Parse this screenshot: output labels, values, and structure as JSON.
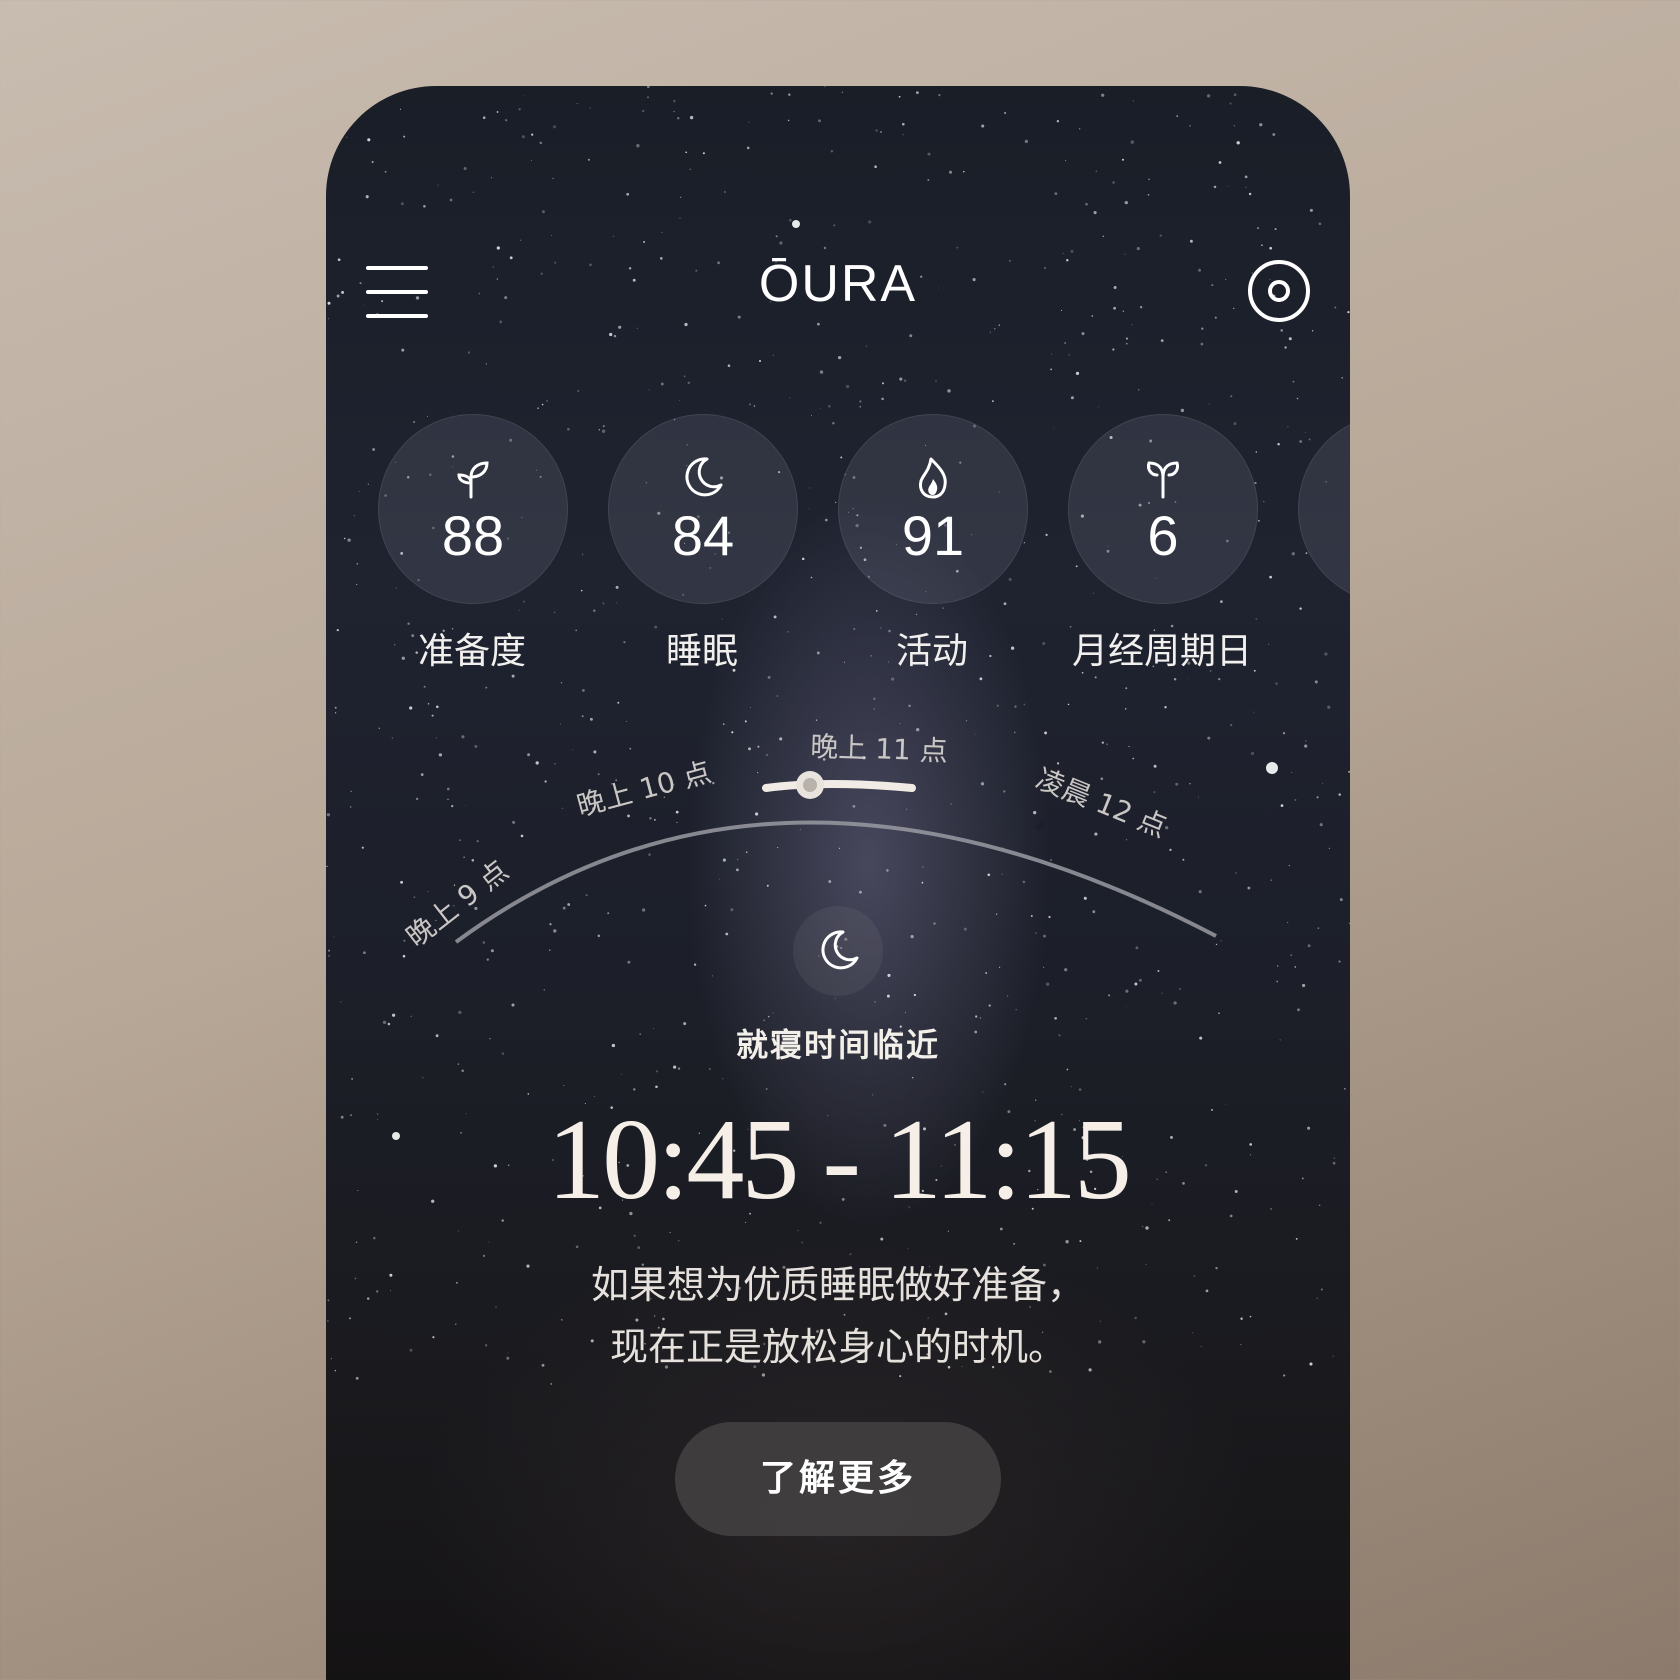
{
  "app": {
    "logo_text": "ŌURA"
  },
  "header": {
    "menu_icon": "hamburger-icon",
    "ring_icon": "ring-icon"
  },
  "scores": [
    {
      "value": "88",
      "label": "准备度",
      "icon": "sprout-icon"
    },
    {
      "value": "84",
      "label": "睡眠",
      "icon": "moon-icon"
    },
    {
      "value": "91",
      "label": "活动",
      "icon": "flame-icon"
    },
    {
      "value": "6",
      "label": "月经周期日",
      "icon": "cycle-icon"
    }
  ],
  "timeline": {
    "labels": [
      "晚上 9 点",
      "晚上 10 点",
      "晚上 11 点",
      "凌晨 12 点"
    ]
  },
  "bedtime": {
    "icon": "moon-icon",
    "title": "就寝时间临近",
    "window": "10:45 - 11:15",
    "desc_line1": "如果想为优质睡眠做好准备，",
    "desc_line2": "现在正是放松身心的时机。",
    "button": "了解更多"
  },
  "colors": {
    "accent": "#ffffff",
    "background": "#1c1f29"
  }
}
